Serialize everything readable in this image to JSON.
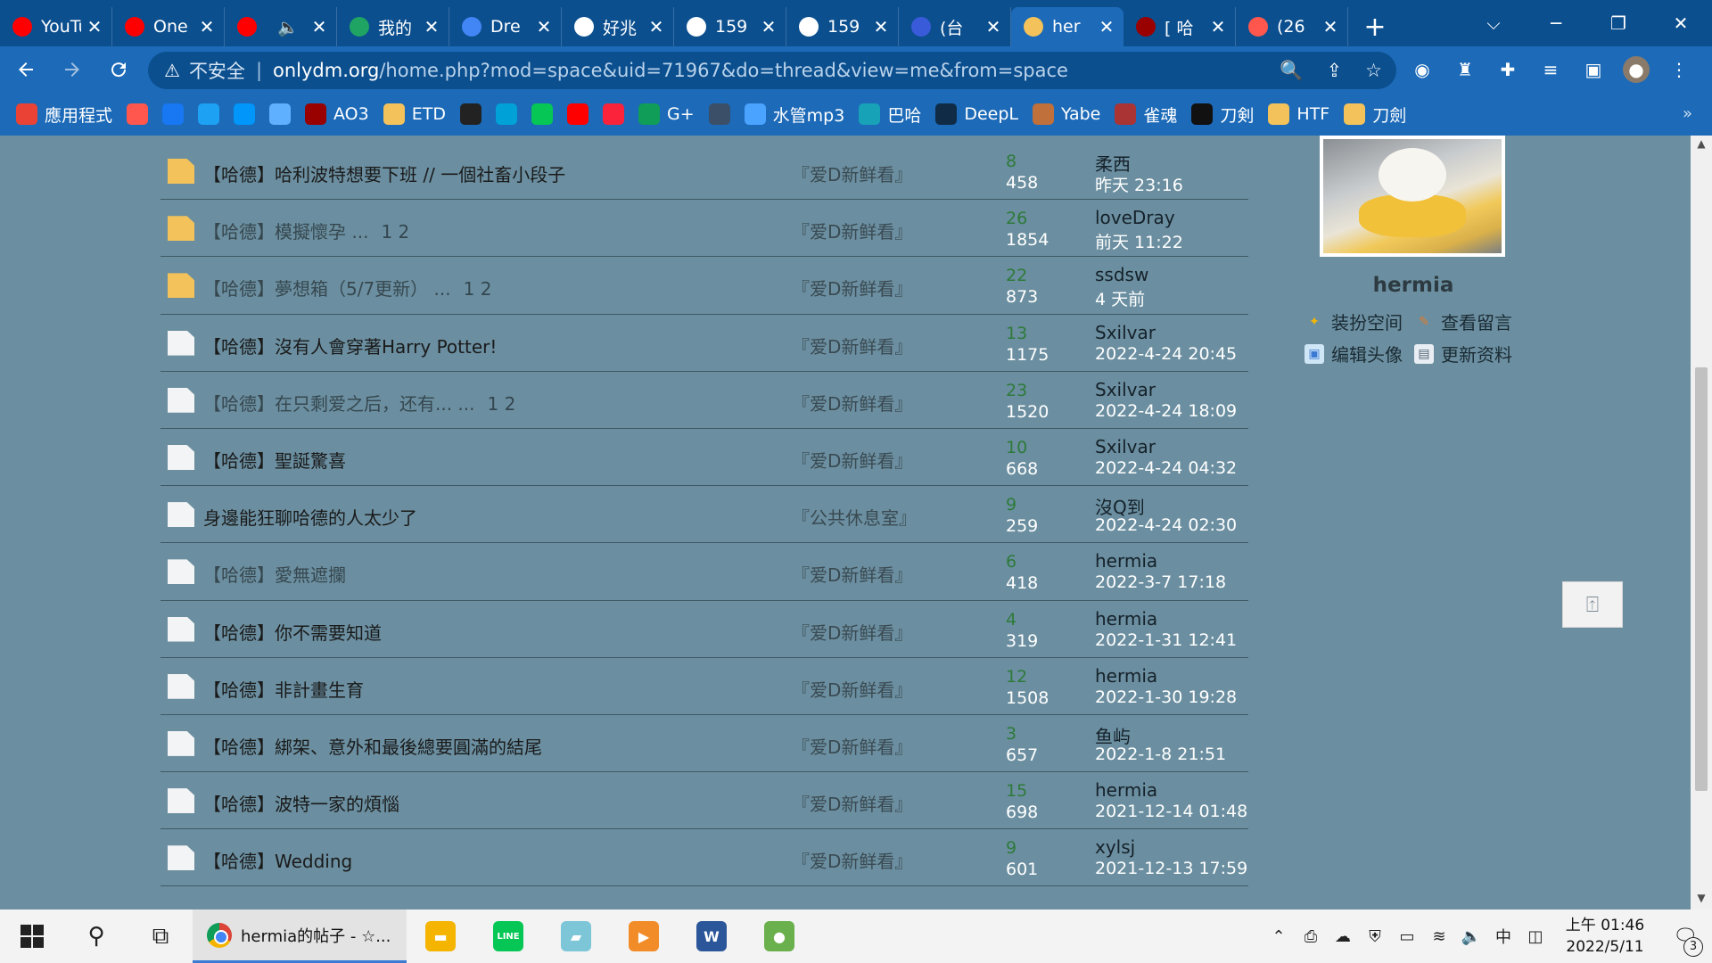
{
  "browser": {
    "tabs": [
      {
        "title": "YouTube",
        "icon": "youtube-icon",
        "color": "#ff0000"
      },
      {
        "title": "One",
        "icon": "youtube-icon",
        "color": "#ff0000"
      },
      {
        "title": "",
        "icon": "youtube-icon",
        "color": "#ff0000",
        "audio": "🔈"
      },
      {
        "title": "我的",
        "icon": "google-drive-icon",
        "color": "#1fa463"
      },
      {
        "title": "Dre",
        "icon": "google-docs-icon",
        "color": "#4285f4"
      },
      {
        "title": "好兆",
        "icon": "google-icon",
        "color": "#ffffff"
      },
      {
        "title": "159",
        "icon": "globe-icon",
        "color": "#ffffff"
      },
      {
        "title": "159",
        "icon": "globe-icon",
        "color": "#ffffff"
      },
      {
        "title": "(台",
        "icon": "book-icon",
        "color": "#3a5bd9"
      },
      {
        "title": "her",
        "icon": "folder-icon",
        "color": "#f4c25a",
        "active": true
      },
      {
        "title": "[ 哈",
        "icon": "ao3-icon",
        "color": "#990000"
      },
      {
        "title": "(26",
        "icon": "plurk-icon",
        "color": "#ff574d"
      }
    ],
    "new_tab": "+",
    "window_controls": {
      "dropdown": "⌵",
      "minimize": "─",
      "restore": "❐",
      "close": "✕"
    },
    "address": {
      "insecure_label": "不安全",
      "host": "onlydm.org",
      "path": "/home.php?mod=space&uid=71967&do=thread&view=me&from=space"
    },
    "bookmarks": [
      {
        "label": "應用程式",
        "icon": "apps-grid-icon",
        "color": "#ea4335"
      },
      {
        "label": "",
        "icon": "plurk-icon",
        "color": "#ff574d"
      },
      {
        "label": "",
        "icon": "facebook-icon",
        "color": "#1877f2"
      },
      {
        "label": "",
        "icon": "twitter-icon",
        "color": "#1da1f2"
      },
      {
        "label": "",
        "icon": "pixiv-icon",
        "color": "#0096fa"
      },
      {
        "label": "",
        "icon": "drop-icon",
        "color": "#5fb0ff"
      },
      {
        "label": "AO3",
        "icon": "ao3-icon",
        "color": "#990000"
      },
      {
        "label": "ETD",
        "icon": "folder-icon",
        "color": "#f4c25a"
      },
      {
        "label": "",
        "icon": "tv-icon",
        "color": "#222222"
      },
      {
        "label": "",
        "icon": "bilibili-icon",
        "color": "#00a1d6"
      },
      {
        "label": "",
        "icon": "line-icon",
        "color": "#06c755"
      },
      {
        "label": "",
        "icon": "youtube-icon",
        "color": "#ff0000"
      },
      {
        "label": "",
        "icon": "music-icon",
        "color": "#fa233b"
      },
      {
        "label": "G+",
        "icon": "hangouts-icon",
        "color": "#0f9d58"
      },
      {
        "label": "",
        "icon": "lj-icon",
        "color": "#3b5068"
      },
      {
        "label": "水管mp3",
        "icon": "headphone-icon",
        "color": "#4aa3ff"
      },
      {
        "label": "巴哈",
        "icon": "bahamut-icon",
        "color": "#17a2b8"
      },
      {
        "label": "DeepL",
        "icon": "deepl-icon",
        "color": "#0f2b46"
      },
      {
        "label": "Yabe",
        "icon": "yabe-icon",
        "color": "#c0703a"
      },
      {
        "label": "雀魂",
        "icon": "mahjong-icon",
        "color": "#a33"
      },
      {
        "label": "刀剣",
        "icon": "dmm-icon",
        "color": "#111111"
      },
      {
        "label": "HTF",
        "icon": "folder-icon",
        "color": "#f4c25a"
      },
      {
        "label": "刀劍",
        "icon": "folder-icon",
        "color": "#f4c25a"
      }
    ],
    "bookmarks_more": "»"
  },
  "threads": [
    {
      "subject": "【哈德】哈利波特想要下班 // 一個社畜小段子",
      "pages": "",
      "forum": "『爱D新鲜看』",
      "replies": "8",
      "views": "458",
      "last_poster": "柔西",
      "last_date": "昨天 23:16",
      "hot": true,
      "visited": false
    },
    {
      "subject": "【哈德】模擬懷孕 ...",
      "pages": "1   2",
      "forum": "『爱D新鲜看』",
      "replies": "26",
      "views": "1854",
      "last_poster": "loveDray",
      "last_date": "前天 11:22",
      "hot": true,
      "visited": true
    },
    {
      "subject": "【哈德】夢想箱（5/7更新） ...",
      "pages": "1   2",
      "forum": "『爱D新鲜看』",
      "replies": "22",
      "views": "873",
      "last_poster": "ssdsw",
      "last_date": "4 天前",
      "hot": true,
      "visited": true
    },
    {
      "subject": "【哈德】沒有人會穿著Harry Potter!",
      "pages": "",
      "forum": "『爱D新鲜看』",
      "replies": "13",
      "views": "1175",
      "last_poster": "Sxilvar",
      "last_date": "2022-4-24 20:45",
      "hot": false,
      "visited": false
    },
    {
      "subject": "【哈德】在只剩爱之后，还有... ...",
      "pages": "1   2",
      "forum": "『爱D新鲜看』",
      "replies": "23",
      "views": "1520",
      "last_poster": "Sxilvar",
      "last_date": "2022-4-24 18:09",
      "hot": false,
      "visited": true
    },
    {
      "subject": "【哈德】聖誕驚喜",
      "pages": "",
      "forum": "『爱D新鲜看』",
      "replies": "10",
      "views": "668",
      "last_poster": "Sxilvar",
      "last_date": "2022-4-24 04:32",
      "hot": false,
      "visited": false
    },
    {
      "subject": "身邊能狂聊哈德的人太少了",
      "pages": "",
      "forum": "『公共休息室』",
      "replies": "9",
      "views": "259",
      "last_poster": "沒Q到",
      "last_date": "2022-4-24 02:30",
      "hot": false,
      "visited": false
    },
    {
      "subject": "【哈德】愛無遮攔",
      "pages": "",
      "forum": "『爱D新鲜看』",
      "replies": "6",
      "views": "418",
      "last_poster": "hermia",
      "last_date": "2022-3-7 17:18",
      "hot": false,
      "visited": true
    },
    {
      "subject": "【哈德】你不需要知道",
      "pages": "",
      "forum": "『爱D新鲜看』",
      "replies": "4",
      "views": "319",
      "last_poster": "hermia",
      "last_date": "2022-1-31 12:41",
      "hot": false,
      "visited": false
    },
    {
      "subject": "【哈德】非計畫生育",
      "pages": "",
      "forum": "『爱D新鲜看』",
      "replies": "12",
      "views": "1508",
      "last_poster": "hermia",
      "last_date": "2022-1-30 19:28",
      "hot": false,
      "visited": false
    },
    {
      "subject": "【哈德】綁架、意外和最後總要圓滿的結尾",
      "pages": "",
      "forum": "『爱D新鲜看』",
      "replies": "3",
      "views": "657",
      "last_poster": "鱼屿",
      "last_date": "2022-1-8 21:51",
      "hot": false,
      "visited": false
    },
    {
      "subject": "【哈德】波特一家的煩惱",
      "pages": "",
      "forum": "『爱D新鲜看』",
      "replies": "15",
      "views": "698",
      "last_poster": "hermia",
      "last_date": "2021-12-14 01:48",
      "hot": false,
      "visited": false
    },
    {
      "subject": "【哈德】Wedding",
      "pages": "",
      "forum": "『爱D新鲜看』",
      "replies": "9",
      "views": "601",
      "last_poster": "xylsj",
      "last_date": "2021-12-13 17:59",
      "hot": false,
      "visited": false
    }
  ],
  "profile": {
    "username": "hermia",
    "links": {
      "decorate": "装扮空间",
      "messages": "查看留言",
      "edit_avatar": "编辑头像",
      "update_profile": "更新资料"
    },
    "back_to_top": "⍐"
  },
  "taskbar": {
    "active_task": "hermia的帖子 - ☆...",
    "apps": [
      {
        "icon": "file-explorer-icon",
        "color": "#f4b400",
        "glyph": "▬"
      },
      {
        "icon": "line-icon",
        "color": "#06c755",
        "glyph": "LINE"
      },
      {
        "icon": "notes-icon",
        "color": "#7cc6d8",
        "glyph": "▰"
      },
      {
        "icon": "media-player-icon",
        "color": "#f28c28",
        "glyph": "▶"
      },
      {
        "icon": "word-icon",
        "color": "#2b579a",
        "glyph": "W"
      },
      {
        "icon": "game-icon",
        "color": "#6ab04c",
        "glyph": "●"
      }
    ],
    "ime": "中",
    "time": "上午 01:46",
    "date": "2022/5/11",
    "notification_count": "3"
  }
}
